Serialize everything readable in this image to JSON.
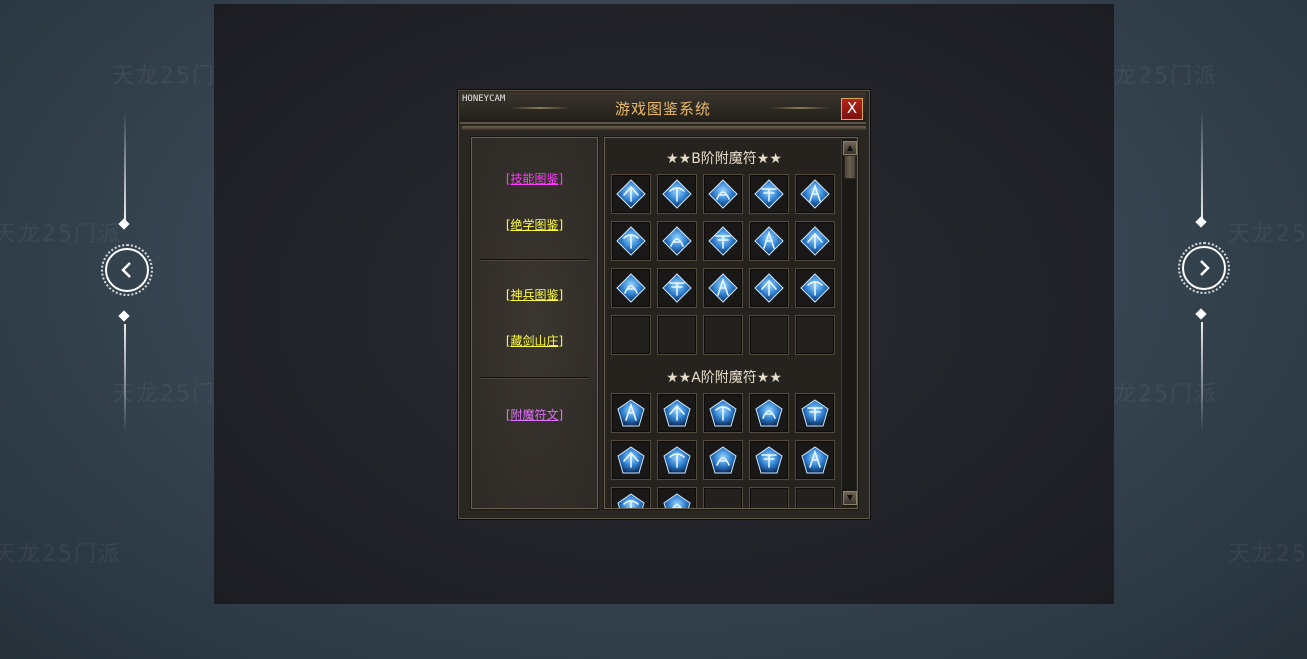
{
  "watermark_text": "天龙25门派",
  "window": {
    "brand": "HONEYCAM",
    "title": "游戏图鉴系统",
    "close_label": "X"
  },
  "menu": {
    "items": [
      {
        "label": "[技能图鉴]",
        "color": "#ff3cff"
      },
      {
        "label": "[绝学图鉴]",
        "color": "#ffff40"
      },
      {
        "label": "[神兵图鉴]",
        "color": "#ffff40"
      },
      {
        "label": "[藏剑山庄]",
        "color": "#ffff40"
      },
      {
        "label": "[附魔符文]",
        "color": "#e070ff"
      }
    ]
  },
  "sections": [
    {
      "title": "★★B阶附魔符★★"
    },
    {
      "title": "★★A阶附魔符★★"
    }
  ],
  "nav": {
    "prev_icon": "chevron-left-icon",
    "next_icon": "chevron-right-icon"
  },
  "colors": {
    "title_gold": "#e9b96a",
    "gem_blue": "#2f7fd0",
    "close_red": "#b3241a"
  }
}
